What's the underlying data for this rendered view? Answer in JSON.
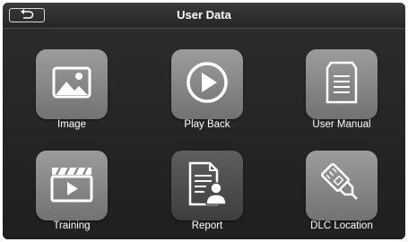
{
  "header": {
    "title": "User Data",
    "back_icon": "back-return-icon"
  },
  "tiles": [
    {
      "label": "Image",
      "icon": "image-icon",
      "style": "gray"
    },
    {
      "label": "Play Back",
      "icon": "play-icon",
      "style": "gray"
    },
    {
      "label": "User Manual",
      "icon": "document-icon",
      "style": "gray"
    },
    {
      "label": "Training",
      "icon": "clapperboard-icon",
      "style": "gray"
    },
    {
      "label": "Report",
      "icon": "report-icon",
      "style": "dark"
    },
    {
      "label": "DLC Location",
      "icon": "connector-icon",
      "style": "gray"
    }
  ]
}
